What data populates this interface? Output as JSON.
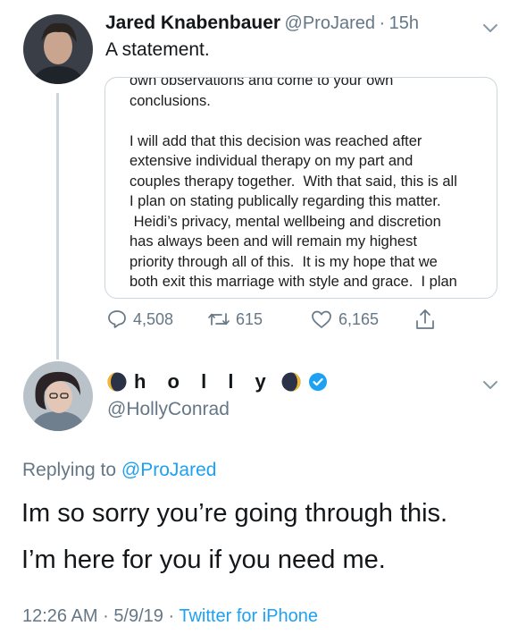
{
  "tweet1": {
    "author_name": "Jared Knabenbauer",
    "handle": "@ProJared",
    "separator": "·",
    "time": "15h",
    "text": "A statement.",
    "quote_image_text": "own observations and come to your own\nconclusions.\n\nI will add that this decision was reached after\nextensive individual therapy on my part and\ncouples therapy together.  With that said, this is all\nI plan on stating publically regarding this matter.\n Heidi’s privacy, mental wellbeing and discretion\nhas always been and will remain my highest\npriority through all of this.  It is my hope that we\nboth exit this marriage with style and grace.  I plan",
    "actions": {
      "reply_count": "4,508",
      "retweet_count": "615",
      "like_count": "6,165"
    }
  },
  "tweet2": {
    "display_name_letters": "h o l l y",
    "handle": "@HollyConrad",
    "replying_prefix": "Replying to",
    "replying_handle": "@ProJared",
    "text_line1": "Im so sorry you’re going through this.",
    "text_line2": "I’m here for you if you need me.",
    "time": "12:26 AM",
    "separator": "·",
    "date": "5/9/19",
    "separator2": "·",
    "source": "Twitter for iPhone"
  },
  "colors": {
    "accent": "#1da1f2",
    "muted": "#657786",
    "text": "#14171a",
    "border": "#ccd6dd"
  },
  "icons": [
    "reply-icon",
    "retweet-icon",
    "like-icon",
    "share-icon",
    "chevron-down-icon",
    "verified-badge-icon",
    "moon-emoji-icon"
  ]
}
